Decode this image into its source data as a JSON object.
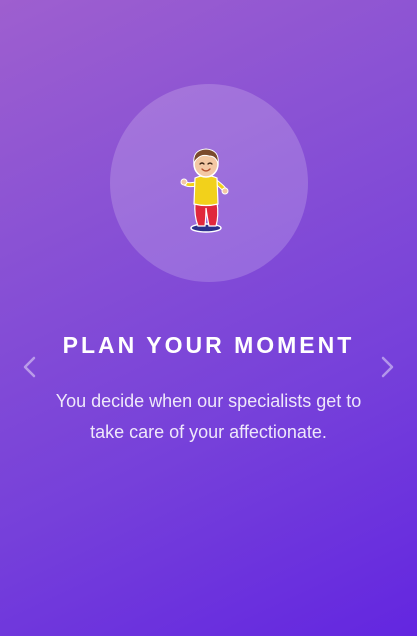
{
  "slide": {
    "title": "PLAN YOUR MOMENT",
    "description": "You decide when our specialists get to take care of your affectionate.",
    "illustration": "dancing-child-illustration"
  },
  "navigation": {
    "prev_icon": "chevron-left-icon",
    "next_icon": "chevron-right-icon"
  },
  "colors": {
    "gradient_start": "#9e5fcf",
    "gradient_end": "#6326e0",
    "text": "#ffffff"
  }
}
